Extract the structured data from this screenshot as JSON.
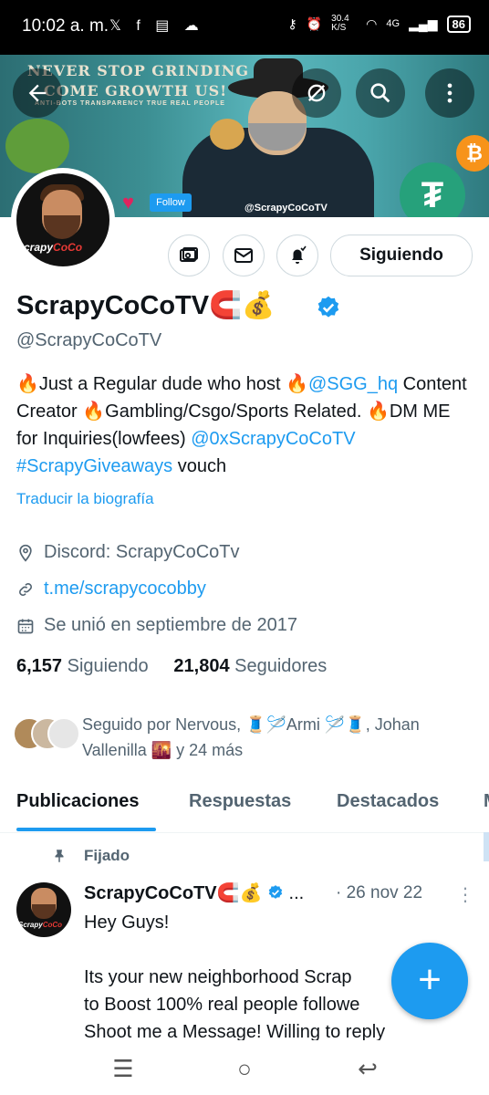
{
  "status_bar": {
    "time": "10:02 a. m.",
    "left_icons": "𝕏 f ▤ ☁",
    "net_speed": "30.4 K/S",
    "network": "4G",
    "battery": "86"
  },
  "banner": {
    "slogan_line1": "NEVER STOP GRINDING",
    "slogan_line2": "COME GROWTH US!",
    "tags": "ANTI-BOTS   TRANSPARENCY   TRUE   REAL PEOPLE",
    "watermark": "@ScrapyCoCoTV",
    "follow_chip": "Follow"
  },
  "avatar_text": {
    "a": "Scrapy",
    "b": "CoCo"
  },
  "actions": {
    "follow_label": "Siguiendo"
  },
  "profile": {
    "name": "ScrapyCoCoTV🧲💰",
    "handle": "@ScrapyCoCoTV",
    "bio": {
      "p1": "🔥Just a Regular dude who host 🔥",
      "m1": "@SGG_hq",
      "p2": " Content Creator 🔥Gambling/Csgo/Sports Related. 🔥DM ME for Inquiries(lowfees) ",
      "m2": "@0xScrapyCoCoTV",
      "sp": " ",
      "m3": "#ScrapyGiveaways",
      "p3": " vouch"
    },
    "translate": "Traducir la biografía",
    "location": "Discord: ScrapyCoCoTv",
    "website": "t.me/scrapycocobby",
    "joined": "Se unió en septiembre de 2017",
    "following_count": "6,157",
    "following_label": "Siguiendo",
    "followers_count": "21,804",
    "followers_label": "Seguidores",
    "followed_by": "Seguido por Nervous, 🧵🪡Armi 🪡🧵, Johan Vallenilla 🌇 y 24 más"
  },
  "tabs": [
    "Publicaciones",
    "Respuestas",
    "Destacados",
    "M"
  ],
  "tweet": {
    "pinned_label": "Fijado",
    "author": "ScrapyCoCoTV🧲💰",
    "ellipsis": "...",
    "date": "· 26 nov 22",
    "body": "Hey Guys!\n\nIts your new neighborhood Scrap\nto Boost 100% real people followe\nShoot me a Message! Willing to reply"
  },
  "colors": {
    "accent": "#1d9bf0",
    "text": "#0f1419",
    "secondary": "#536471"
  },
  "icons": [
    "back-arrow-icon",
    "no-sync-icon",
    "search-icon",
    "more-vertical-icon",
    "wallet-icon",
    "mail-icon",
    "bell-check-icon",
    "verified-badge-icon",
    "location-icon",
    "link-icon",
    "calendar-icon",
    "pin-icon",
    "plus-icon"
  ]
}
